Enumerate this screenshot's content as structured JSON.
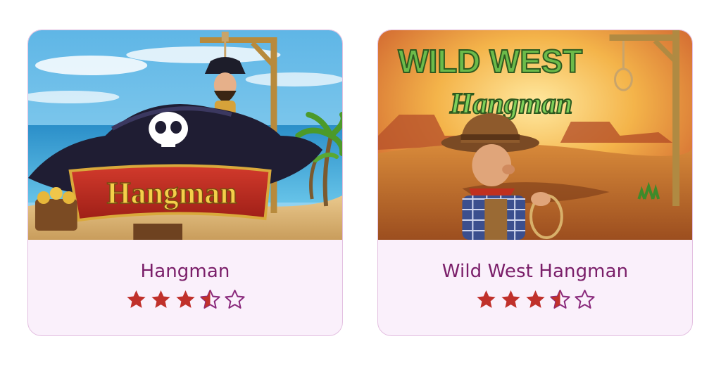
{
  "games": [
    {
      "title": "Hangman",
      "rating": 3.5,
      "rating_max": 5,
      "thumbnail_text": "Hangman",
      "icon": "pirate-hangman-thumbnail"
    },
    {
      "title": "Wild West Hangman",
      "rating": 3.5,
      "rating_max": 5,
      "thumbnail_text_line1": "WILD WEST",
      "thumbnail_text_line2": "Hangman",
      "icon": "cowboy-hangman-thumbnail"
    }
  ],
  "colors": {
    "star_fill": "#c0312b",
    "star_empty_stroke": "#8a2a7c",
    "title": "#7a1e69",
    "card_border": "#e3bfe0",
    "card_caption_bg": "#faf0fb"
  }
}
